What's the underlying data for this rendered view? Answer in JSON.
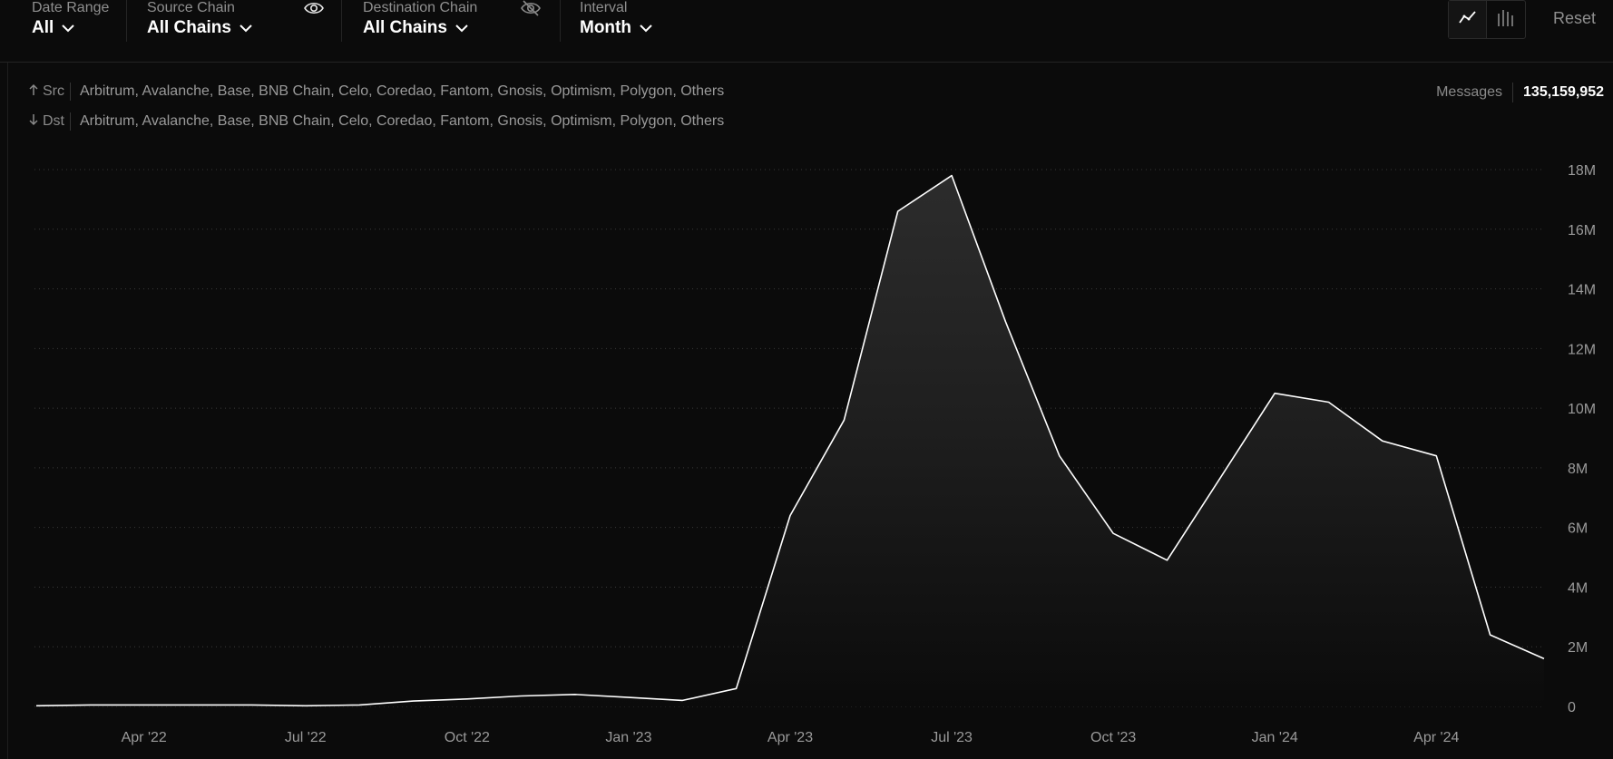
{
  "filters": {
    "date_range": {
      "label": "Date Range",
      "value": "All"
    },
    "source_chain": {
      "label": "Source Chain",
      "value": "All Chains",
      "icon": "eye-icon"
    },
    "destination_chain": {
      "label": "Destination Chain",
      "value": "All Chains",
      "icon": "eye-off-icon"
    },
    "interval": {
      "label": "Interval",
      "value": "Month"
    }
  },
  "toolbar": {
    "line_view_icon": "line-chart-icon",
    "bar_view_icon": "bar-chart-icon",
    "reset_label": "Reset"
  },
  "routes": {
    "src_label": "Src",
    "dst_label": "Dst",
    "src_chains": "Arbitrum, Avalanche, Base, BNB Chain, Celo, Coredao, Fantom, Gnosis, Optimism, Polygon, Others",
    "dst_chains": "Arbitrum, Avalanche, Base, BNB Chain, Celo, Coredao, Fantom, Gnosis, Optimism, Polygon, Others"
  },
  "summary": {
    "messages_label": "Messages",
    "messages_value": "135,159,952"
  },
  "colors": {
    "background": "#0b0b0b",
    "line": "#ffffff",
    "grid": "#3a3a3a",
    "axis_text": "#9a9a9a"
  },
  "chart_data": {
    "type": "area",
    "x": [
      "2022-02",
      "2022-03",
      "2022-04",
      "2022-05",
      "2022-06",
      "2022-07",
      "2022-08",
      "2022-09",
      "2022-10",
      "2022-11",
      "2022-12",
      "2023-01",
      "2023-02",
      "2023-03",
      "2023-04",
      "2023-05",
      "2023-06",
      "2023-07",
      "2023-08",
      "2023-09",
      "2023-10",
      "2023-11",
      "2023-12",
      "2024-01",
      "2024-02",
      "2024-03",
      "2024-04",
      "2024-05",
      "2024-06"
    ],
    "values": [
      0.02,
      0.05,
      0.05,
      0.05,
      0.05,
      0.02,
      0.05,
      0.18,
      0.25,
      0.35,
      0.4,
      0.3,
      0.2,
      0.6,
      6.4,
      9.6,
      16.6,
      17.8,
      12.9,
      8.4,
      5.8,
      4.9,
      7.7,
      10.5,
      10.2,
      8.9,
      8.4,
      2.4,
      1.6
    ],
    "x_tick_labels": [
      "Apr '22",
      "Jul '22",
      "Oct '22",
      "Jan '23",
      "Apr '23",
      "Jul '23",
      "Oct '23",
      "Jan '24",
      "Apr '24"
    ],
    "x_tick_positions": [
      "2022-04",
      "2022-07",
      "2022-10",
      "2023-01",
      "2023-04",
      "2023-07",
      "2023-10",
      "2024-01",
      "2024-04"
    ],
    "y_ticks": [
      0,
      2,
      4,
      6,
      8,
      10,
      12,
      14,
      16,
      18
    ],
    "y_tick_labels": [
      "0",
      "2M",
      "4M",
      "6M",
      "8M",
      "10M",
      "12M",
      "14M",
      "16M",
      "18M"
    ],
    "y_unit": "M",
    "ylim": [
      0,
      18
    ],
    "grid": true,
    "y_axis_side": "right",
    "legend": false
  }
}
